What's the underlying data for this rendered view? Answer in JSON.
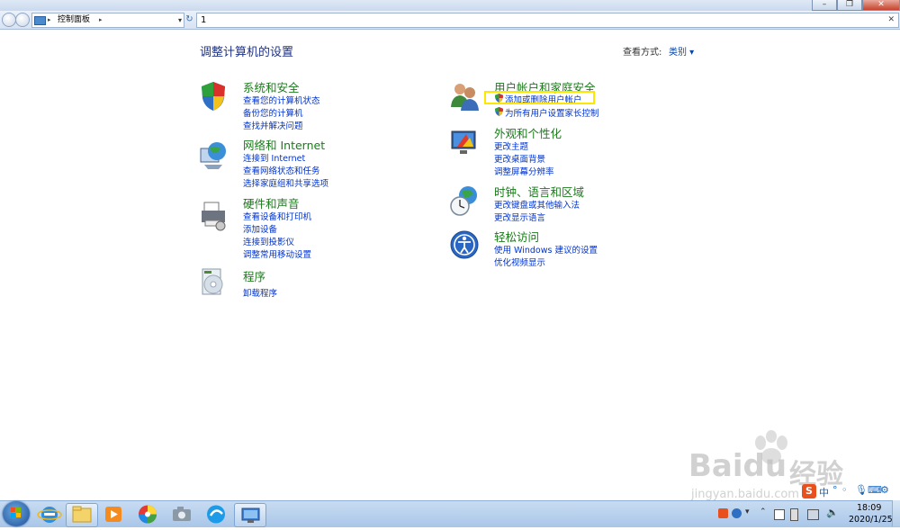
{
  "address": {
    "breadcrumb": "控制面板",
    "search_value": "1"
  },
  "main": {
    "title": "调整计算机的设置",
    "view_by_label": "查看方式:",
    "view_by_value": "类别 ▾"
  },
  "categories": [
    {
      "title": "系统和安全",
      "links": [
        "查看您的计算机状态",
        "备份您的计算机",
        "查找并解决问题"
      ]
    },
    {
      "title": "网络和 Internet",
      "links": [
        "连接到 Internet",
        "查看网络状态和任务",
        "选择家庭组和共享选项"
      ]
    },
    {
      "title": "硬件和声音",
      "links": [
        "查看设备和打印机",
        "添加设备",
        "连接到投影仪",
        "调整常用移动设置"
      ]
    },
    {
      "title": "程序",
      "links": [
        "卸载程序"
      ]
    },
    {
      "title": "用户帐户和家庭安全",
      "links": [
        "添加或删除用户帐户",
        "为所有用户设置家长控制"
      ]
    },
    {
      "title": "外观和个性化",
      "links": [
        "更改主题",
        "更改桌面背景",
        "调整屏幕分辨率"
      ]
    },
    {
      "title": "时钟、语言和区域",
      "links": [
        "更改键盘或其他输入法",
        "更改显示语言"
      ]
    },
    {
      "title": "轻松访问",
      "links": [
        "使用 Windows 建议的设置",
        "优化视频显示"
      ]
    }
  ],
  "taskbar": {
    "time": "18:09",
    "date": "2020/1/25"
  },
  "ime": {
    "lang": "中"
  },
  "watermark": {
    "brand": "Baidu",
    "cn": "经验",
    "url": "jingyan.baidu.com"
  },
  "colors": {
    "category_title": "#1a7b1a",
    "link": "#0033cc",
    "page_title": "#1e3287",
    "highlight": "#ffe600"
  }
}
